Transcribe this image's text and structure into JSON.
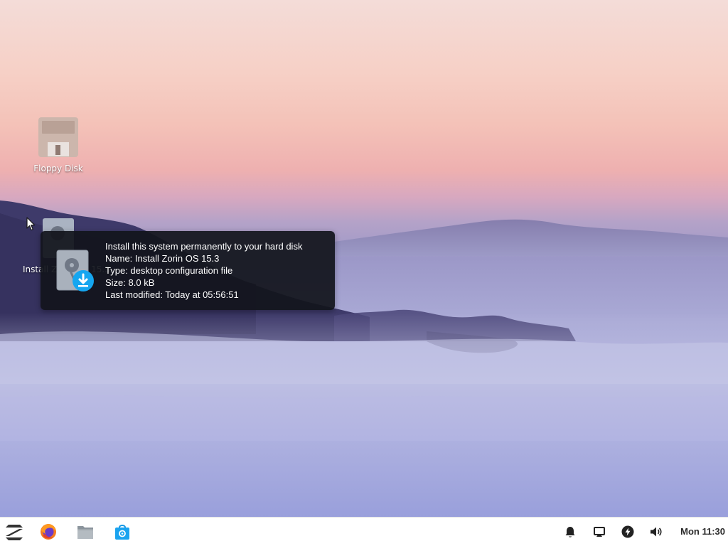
{
  "desktop": {
    "icons": [
      {
        "label": "Floppy Disk",
        "icon": "floppy-disk-icon"
      },
      {
        "label": "Install Zorin OS 15.3",
        "icon": "installer-icon"
      }
    ]
  },
  "tooltip": {
    "icon": "installer-icon",
    "lines": [
      "Install this system permanently to your hard disk",
      "Name: Install Zorin OS 15.3",
      "Type: desktop configuration file",
      "Size: 8.0 kB",
      "Last modified: Today at 05:56:51"
    ]
  },
  "taskbar": {
    "launchers": [
      {
        "icon": "zorin-menu-icon"
      },
      {
        "icon": "firefox-icon"
      },
      {
        "icon": "files-icon"
      },
      {
        "icon": "software-store-icon"
      }
    ],
    "tray": [
      {
        "icon": "notification-bell-icon"
      },
      {
        "icon": "display-icon"
      },
      {
        "icon": "power-icon"
      },
      {
        "icon": "volume-icon"
      }
    ],
    "clock": "Mon 11:30"
  },
  "colors": {
    "tooltip_bg": "#12141c",
    "taskbar_bg": "#ffffff",
    "accent_blue": "#15a6f0",
    "firefox_orange": "#f47b20"
  }
}
